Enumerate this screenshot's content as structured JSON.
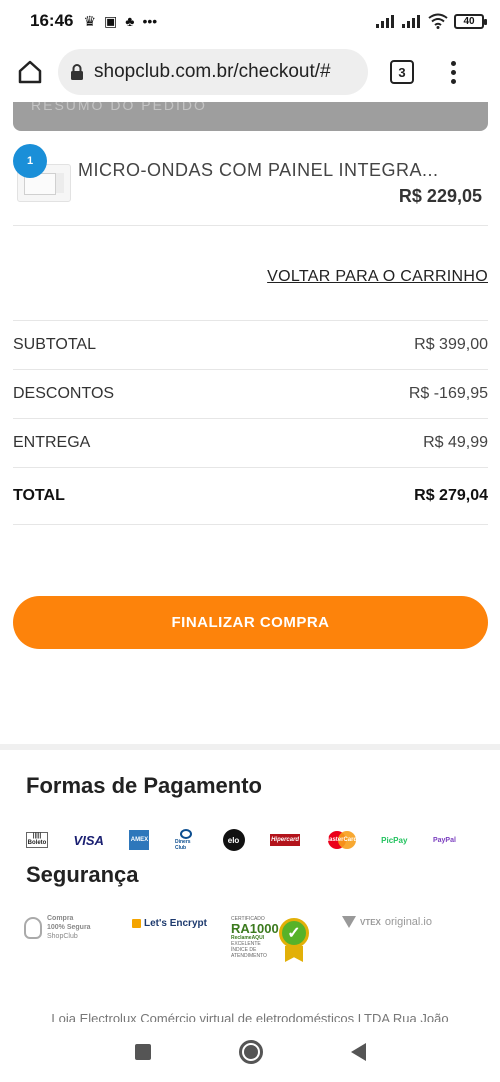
{
  "status_bar": {
    "time": "16:46",
    "notification_icons": [
      "crown-icon",
      "message-icon",
      "app-icon",
      "more-dots-icon"
    ],
    "battery": "40"
  },
  "browser": {
    "url": "shopclub.com.br/checkout/#",
    "tab_count": "3"
  },
  "order": {
    "summary_header": "RESUMO DO PEDIDO",
    "item": {
      "quantity": "1",
      "name": "MICRO-ONDAS COM PAINEL INTEGRA...",
      "price": "R$ 229,05"
    },
    "back_link": "VOLTAR PARA O CARRINHO",
    "totals": [
      {
        "label": "SUBTOTAL",
        "value": "R$ 399,00"
      },
      {
        "label": "DESCONTOS",
        "value": "R$ -169,95"
      },
      {
        "label": "ENTREGA",
        "value": "R$ 49,99"
      }
    ],
    "total": {
      "label": "TOTAL",
      "value": "R$ 279,04"
    },
    "finalize_label": "FINALIZAR COMPRA"
  },
  "footer": {
    "payment_title": "Formas de Pagamento",
    "payment_logos": {
      "boleto": "Boleto",
      "visa": "VISA",
      "amex": "AMEX",
      "diners": "Diners Club",
      "elo": "elo",
      "hipercard": "Hipercard",
      "mastercard": "MasterCard",
      "picpay": "PicPay",
      "paypal": "PayPal"
    },
    "security_title": "Segurança",
    "security_seals": {
      "compra_line1": "Compra",
      "compra_line2": "100% Segura",
      "compra_line3": "ShopClub",
      "lets_encrypt": "Let's Encrypt",
      "ra_certificado": "CERTIFICADO",
      "ra_big": "RA1000",
      "ra_brand": "ReclameAQUI",
      "ra_caption": "EXCELENTE ÍNDICE DE ATENDIMENTO",
      "vtex": "VTEX",
      "original": "original.io"
    },
    "company_text": "Loja Electrolux Comércio virtual de eletrodomésticos LTDA Rua João"
  },
  "colors": {
    "accent": "#fd830b",
    "badge": "#1a8fd8",
    "header_gray": "#9e9e9e"
  }
}
